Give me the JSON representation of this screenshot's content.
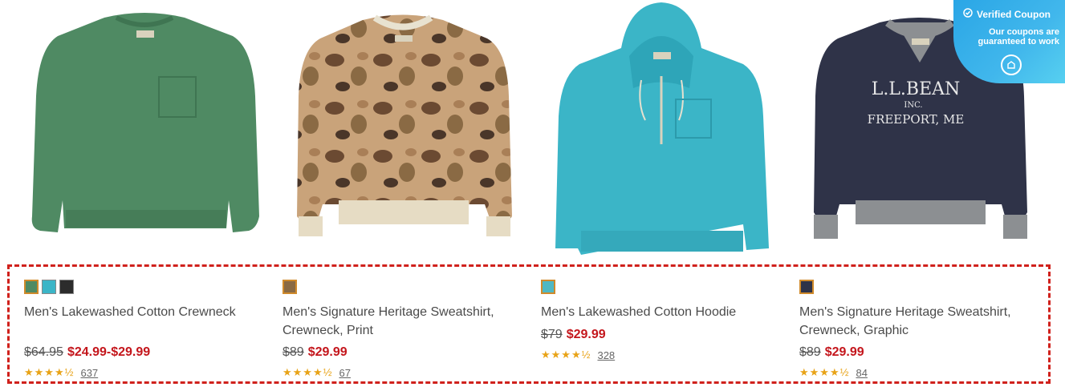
{
  "coupon": {
    "heading": "Verified Coupon",
    "text": "Our coupons are guaranteed to work",
    "check_icon": "check-circle-icon",
    "logo_icon": "shield-logo-icon"
  },
  "products": [
    {
      "title": "Men's Lakewashed Cotton Crewneck",
      "image_desc": "green-crewneck",
      "swatches": [
        "#4f8a63",
        "#3bb5c7",
        "#2c2c2c"
      ],
      "old_price": "$64.95",
      "new_price": "$24.99-$29.99",
      "rating": 4.5,
      "reviews": "637"
    },
    {
      "title": "Men's Signature Heritage Sweatshirt, Crewneck, Print",
      "image_desc": "camo-crewneck",
      "swatches": [
        "#8a6a44"
      ],
      "old_price": "$89",
      "new_price": "$29.99",
      "rating": 4.5,
      "reviews": "67"
    },
    {
      "title": "Men's Lakewashed Cotton Hoodie",
      "image_desc": "aqua-hoodie",
      "swatches": [
        "#4fb8c4"
      ],
      "old_price": "$79",
      "new_price": "$29.99",
      "rating": 4.5,
      "reviews": "328"
    },
    {
      "title": "Men's Signature Heritage Sweatshirt, Crewneck, Graphic",
      "image_desc": "navy-crewneck",
      "image_text": [
        "L.L.BEAN",
        "INC.",
        "FREEPORT, ME"
      ],
      "swatches": [
        "#2f3348"
      ],
      "old_price": "$89",
      "new_price": "$29.99",
      "rating": 4.5,
      "reviews": "84"
    }
  ],
  "colors": {
    "sale_red": "#c4161c",
    "star_gold": "#e8a317",
    "highlight_border": "#d0211c"
  }
}
